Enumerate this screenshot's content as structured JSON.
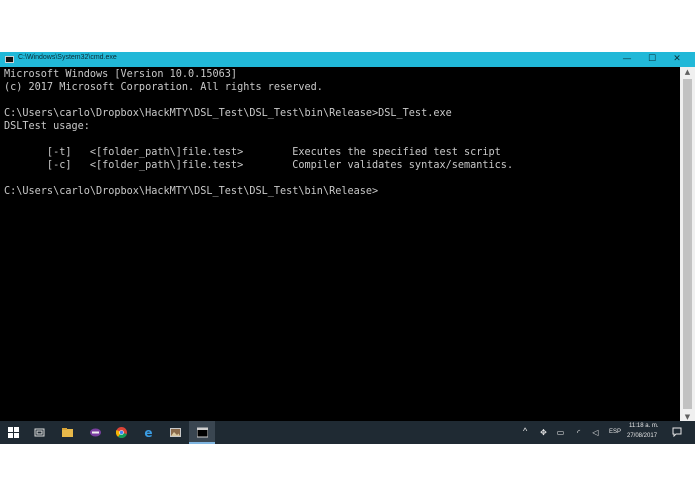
{
  "window": {
    "title": "C:\\Windows\\System32\\cmd.exe",
    "minimize_glyph": "—",
    "maximize_glyph": "☐",
    "close_glyph": "✕"
  },
  "console": {
    "lines": [
      "Microsoft Windows [Version 10.0.15063]",
      "(c) 2017 Microsoft Corporation. All rights reserved.",
      "",
      "C:\\Users\\carlo\\Dropbox\\HackMTY\\DSL_Test\\DSL_Test\\bin\\Release>DSL_Test.exe",
      "DSLTest usage:",
      "",
      "       [-t]   <[folder_path\\]file.test>        Executes the specified test script",
      "       [-c]   <[folder_path\\]file.test>        Compiler validates syntax/semantics.",
      "",
      "C:\\Users\\carlo\\Dropbox\\HackMTY\\DSL_Test\\DSL_Test\\bin\\Release>"
    ]
  },
  "scrollbar": {
    "up_glyph": "▲",
    "down_glyph": "▼"
  },
  "taskbar": {
    "apps": [
      {
        "name": "start-button",
        "icon": "windows-logo-icon"
      },
      {
        "name": "task-view-button",
        "icon": "task-view-icon"
      },
      {
        "name": "taskbar-file-explorer",
        "icon": "folder-icon"
      },
      {
        "name": "taskbar-app-purple",
        "icon": "app-icon"
      },
      {
        "name": "taskbar-chrome",
        "icon": "chrome-icon"
      },
      {
        "name": "taskbar-edge",
        "icon": "edge-icon"
      },
      {
        "name": "taskbar-photos",
        "icon": "photos-icon"
      },
      {
        "name": "taskbar-cmd",
        "icon": "cmd-icon"
      }
    ],
    "tray": {
      "chevron": "^",
      "language": "ESP",
      "time": "11:18 a. m.",
      "date": "27/08/2017"
    }
  },
  "colors": {
    "titlebar": "#21b8d8",
    "console_bg": "#000000",
    "console_fg": "#c9c9c9",
    "taskbar": "#1f2a33"
  }
}
